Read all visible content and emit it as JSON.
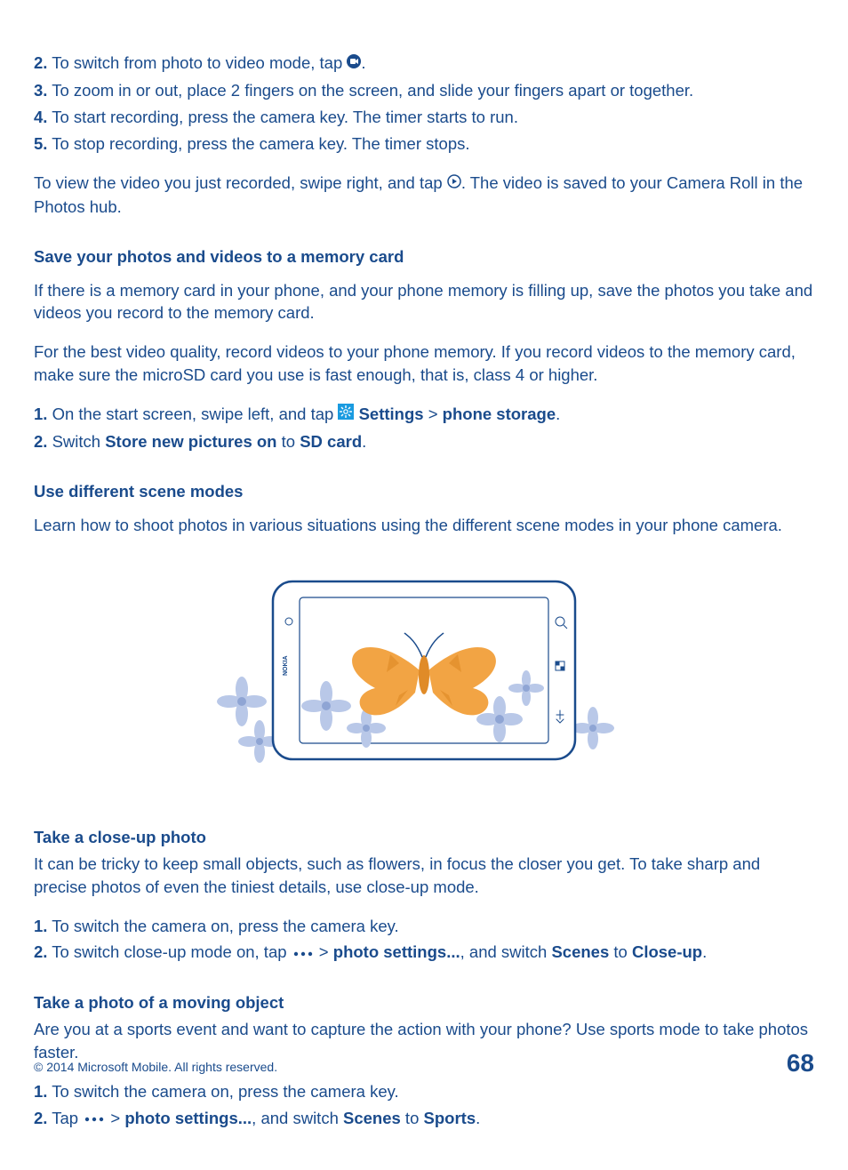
{
  "steps1": {
    "s2": "To switch from photo to video mode, tap ",
    "s2_end": ".",
    "s3": "To zoom in or out, place 2 fingers on the screen, and slide your fingers apart or together.",
    "s4": "To start recording, press the camera key. The timer starts to run.",
    "s5": "To stop recording, press the camera key. The timer stops."
  },
  "view_video_a": "To view the video you just recorded, swipe right, and tap ",
  "view_video_b": ". The video is saved to your Camera Roll in the Photos hub.",
  "save_heading": "Save your photos and videos to a memory card",
  "save_p1": "If there is a memory card in your phone, and your phone memory is filling up, save the photos you take and videos you record to the memory card.",
  "save_p2": "For the best video quality, record videos to your phone memory. If you record videos to the memory card, make sure the microSD card you use is fast enough, that is, class 4 or higher.",
  "save_steps": {
    "s1_a": "On the start screen, swipe left, and tap ",
    "s1_settings": "Settings",
    "s1_gt": " > ",
    "s1_storage": "phone storage",
    "s1_end": ".",
    "s2_a": "Switch ",
    "s2_b": "Store new pictures on",
    "s2_c": " to ",
    "s2_d": "SD card",
    "s2_e": "."
  },
  "scene_heading": "Use different scene modes",
  "scene_p": "Learn how to shoot photos in various situations using the different scene modes in your phone camera.",
  "closeup_heading": "Take a close-up photo",
  "closeup_p": "It can be tricky to keep small objects, such as flowers, in focus the closer you get. To take sharp and precise photos of even the tiniest details, use close-up mode.",
  "closeup_steps": {
    "s1": "To switch the camera on, press the camera key.",
    "s2_a": "To switch close-up mode on, tap ",
    "s2_b": " > ",
    "s2_c": "photo settings...",
    "s2_d": ", and switch ",
    "s2_e": "Scenes",
    "s2_f": " to ",
    "s2_g": "Close-up",
    "s2_h": "."
  },
  "moving_heading": "Take a photo of a moving object",
  "moving_p": "Are you at a sports event and want to capture the action with your phone? Use sports mode to take photos faster.",
  "moving_steps": {
    "s1": "To switch the camera on, press the camera key.",
    "s2_a": "Tap ",
    "s2_b": " > ",
    "s2_c": "photo settings...",
    "s2_d": ", and switch ",
    "s2_e": "Scenes",
    "s2_f": " to ",
    "s2_g": "Sports",
    "s2_h": "."
  },
  "footer": {
    "copyright": "© 2014 Microsoft Mobile. All rights reserved.",
    "page": "68"
  },
  "numbers": {
    "n1": "1.",
    "n2": "2.",
    "n3": "3.",
    "n4": "4.",
    "n5": "5."
  }
}
